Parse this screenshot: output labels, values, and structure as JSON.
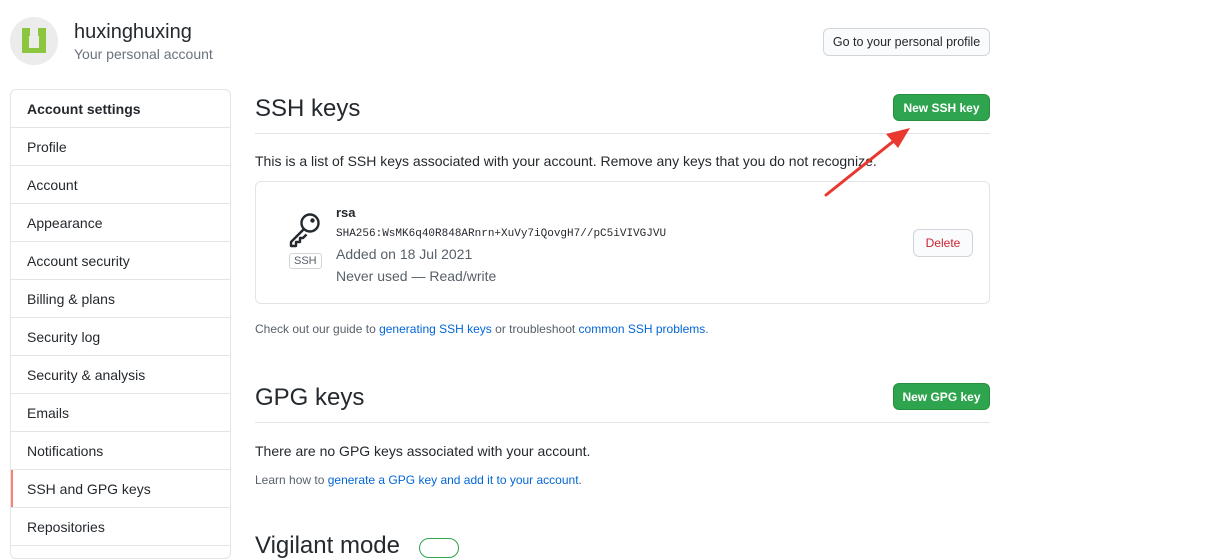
{
  "header": {
    "username": "huxinghuxing",
    "subtitle": "Your personal account",
    "profile_button": "Go to your personal profile",
    "avatar_color": "#8cc63f"
  },
  "sidebar": {
    "heading": "Account settings",
    "items": [
      {
        "label": "Profile",
        "selected": false
      },
      {
        "label": "Account",
        "selected": false
      },
      {
        "label": "Appearance",
        "selected": false
      },
      {
        "label": "Account security",
        "selected": false
      },
      {
        "label": "Billing & plans",
        "selected": false
      },
      {
        "label": "Security log",
        "selected": false
      },
      {
        "label": "Security & analysis",
        "selected": false
      },
      {
        "label": "Emails",
        "selected": false
      },
      {
        "label": "Notifications",
        "selected": false
      },
      {
        "label": "SSH and GPG keys",
        "selected": true
      },
      {
        "label": "Repositories",
        "selected": false
      }
    ],
    "selected_color": "#f9826c"
  },
  "ssh": {
    "heading": "SSH keys",
    "new_button": "New SSH key",
    "description": "This is a list of SSH keys associated with your account. Remove any keys that you do not recognize.",
    "key": {
      "type_label": "SSH",
      "title": "rsa",
      "fingerprint": "SHA256:WsMK6q40R848ARnrn+XuVy7iQovgH7//pC5iVIVGJVU",
      "added": "Added on 18 Jul 2021",
      "usage": "Never used — Read/write",
      "delete_button": "Delete"
    },
    "guide": {
      "prefix": "Check out our guide to ",
      "link1": "generating SSH keys",
      "middle": " or troubleshoot ",
      "link2": "common SSH problems",
      "suffix": "."
    }
  },
  "gpg": {
    "heading": "GPG keys",
    "new_button": "New GPG key",
    "empty": "There are no GPG keys associated with your account.",
    "learn": {
      "prefix": "Learn how to ",
      "link": "generate a GPG key and add it to your account",
      "suffix": "."
    }
  },
  "next_section": {
    "heading": "Vigilant mode"
  },
  "colors": {
    "primary_green": "#2ea44f",
    "link_blue": "#0366d6",
    "danger_red": "#cb2431",
    "annotation_arrow": "#e8382f"
  },
  "icons": {
    "key": "key-icon",
    "annotation": "red-arrow-annotation"
  }
}
